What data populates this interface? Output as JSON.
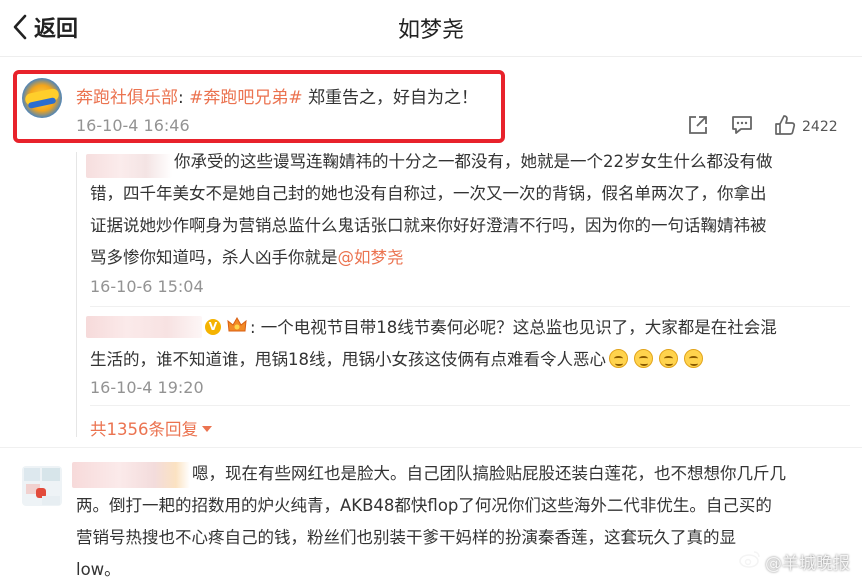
{
  "header": {
    "back_label": "返回",
    "title": "如梦尧"
  },
  "post": {
    "author": "奔跑社俱乐部",
    "colon": ": ",
    "hashtag": "#奔跑吧兄弟#",
    "text": " 郑重告之，好自为之！",
    "time": "16-10-4 16:46",
    "like_count": "2422"
  },
  "replies": [
    {
      "line1": "你承受的这些谩骂连鞠婧祎的十分之一都没有，她就是一个22岁女生什么都没有做",
      "line2": "错，四千年美女不是她自己封的她也没有自称过，一次又一次的背锅，假名单两次了，你拿出",
      "line3": "证据说她炒作啊身为营销总监什么鬼话张口就来你好好澄清不行吗，因为你的一句话鞠婧祎被",
      "line4_prefix": "骂多惨你知道吗，杀人凶手你就是",
      "mention": "@如梦尧",
      "time": "16-10-6 15:04"
    },
    {
      "line1": ": 一个电视节目带18线节奏何必呢？这总监也见识了，大家都是在社会混",
      "line2": "生活的，谁不知道谁，甩锅18线，甩锅小女孩这伎俩有点难看令人恶心",
      "time": "16-10-4 19:20"
    }
  ],
  "more_replies": "共1356条回复",
  "comment2": {
    "line1": "嗯，现在有些网红也是脸大。自己团队搞脸贴屁股还装白莲花，也不想想你几斤几",
    "line2": "两。倒打一耙的招数用的炉火纯青，AKB48都快flop了何况你们这些海外二代非优生。自己买的",
    "line3": "营销号热搜也不心疼自己的钱，粉丝们也别装干爹干妈样的扮演秦香莲，这套玩久了真的显",
    "line4": "low。"
  },
  "watermark": "@羊城晚报",
  "colors": {
    "accent": "#eb7350",
    "highlight_box": "#e8222b",
    "meta_text": "#939393"
  },
  "icons": [
    "back-chevron-icon",
    "share-icon",
    "comment-icon",
    "like-icon",
    "vip-icon",
    "crown-icon",
    "smile-emoji-icon",
    "weibo-icon"
  ]
}
